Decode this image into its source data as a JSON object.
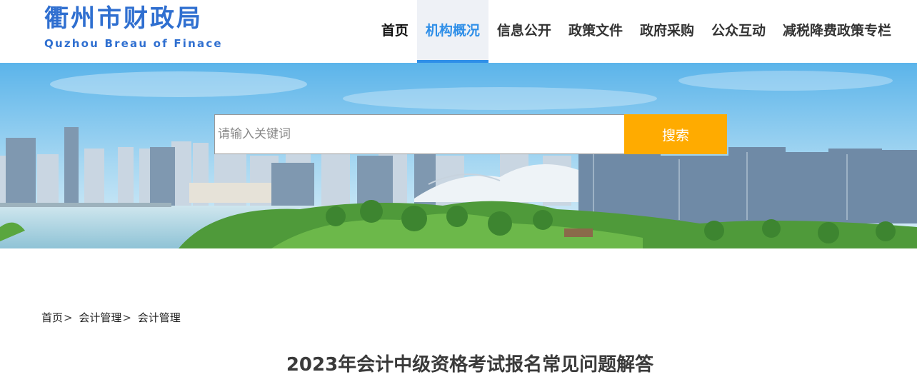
{
  "logo": {
    "name_cn": "衢州市财政局",
    "name_en": "Quzhou Breau of Finace"
  },
  "nav": {
    "items": [
      {
        "label": "首页",
        "active": false
      },
      {
        "label": "机构概况",
        "active": true
      },
      {
        "label": "信息公开",
        "active": false
      },
      {
        "label": "政策文件",
        "active": false
      },
      {
        "label": "政府采购",
        "active": false
      },
      {
        "label": "公众互动",
        "active": false
      },
      {
        "label": "减税降费政策专栏",
        "active": false
      }
    ]
  },
  "search": {
    "placeholder": "请输入关键词",
    "value": "",
    "button_label": "搜索"
  },
  "breadcrumb": {
    "items": [
      "首页",
      "会计管理",
      "会计管理"
    ],
    "separator": ">"
  },
  "article": {
    "title": "2023年会计中级资格考试报名常见问题解答"
  },
  "colors": {
    "brand_blue": "#2f6fd0",
    "active_nav": "#2f8fe8",
    "search_button": "#ffab00"
  }
}
